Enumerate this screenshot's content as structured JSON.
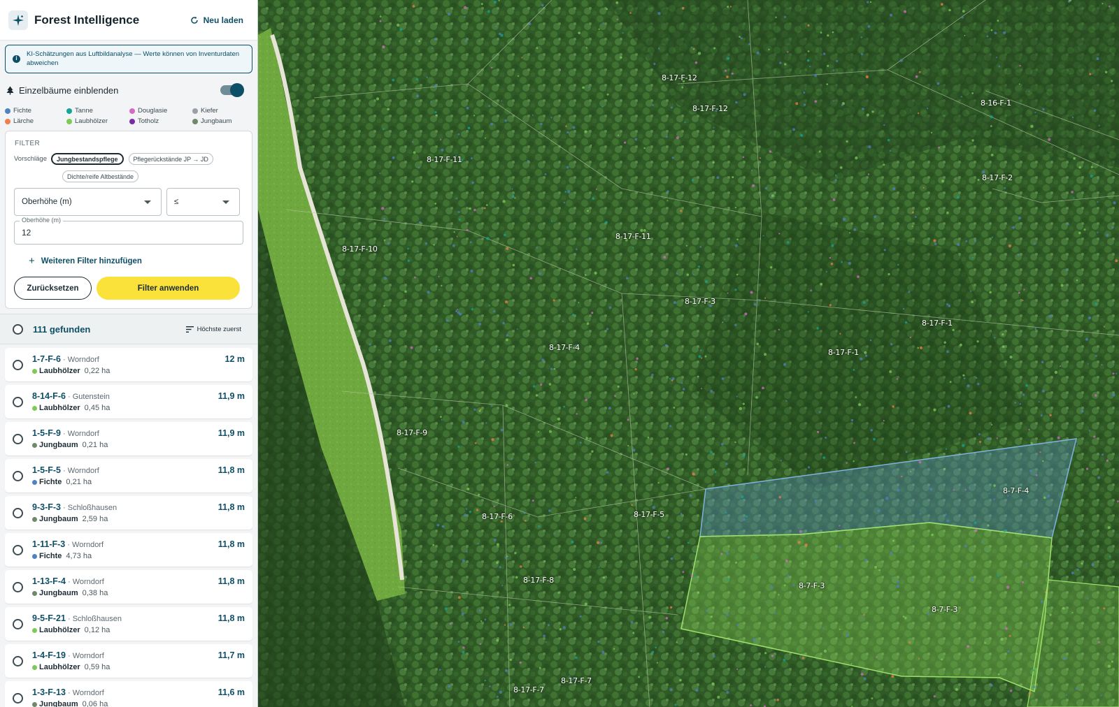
{
  "app": {
    "title": "Forest Intelligence",
    "reload_label": "Neu laden"
  },
  "info": {
    "text": "KI-Schätzungen aus Luftbildanalyse — Werte können von Inventurdaten abweichen"
  },
  "trees_toggle": {
    "label": "Einzelbäume einblenden",
    "on": true
  },
  "legend": [
    {
      "label": "Fichte",
      "color": "#4f82c0"
    },
    {
      "label": "Tanne",
      "color": "#13a59a"
    },
    {
      "label": "Douglasie",
      "color": "#d36dc4"
    },
    {
      "label": "Kiefer",
      "color": "#9aa0a6"
    },
    {
      "label": "Lärche",
      "color": "#f07f4a"
    },
    {
      "label": "Laubhölzer",
      "color": "#7dcb57"
    },
    {
      "label": "Totholz",
      "color": "#7b2aa6"
    },
    {
      "label": "Jungbaum",
      "color": "#6f8a6a"
    }
  ],
  "filter": {
    "heading": "FILTER",
    "suggestions_label": "Vorschläge",
    "suggestions": [
      "Jungbestandspflege",
      "Pflegerückstände JP → JD",
      "Dichte/reife Altbestände"
    ],
    "field_select": "Oberhöhe (m)",
    "operator_select": "≤",
    "value_label": "Oberhöhe (m)",
    "value": "12",
    "add_filter_label": "Weiteren Filter hinzufügen",
    "reset_label": "Zurücksetzen",
    "apply_label": "Filter anwenden"
  },
  "results": {
    "count_label": "111 gefunden",
    "sort_label": "Höchste zuerst",
    "items": [
      {
        "id": "1-7-F-6",
        "loc": " · Worndorf",
        "species": "Laubhölzer",
        "species_color": "#7dcb57",
        "area": "0,22 ha",
        "height": "12 m"
      },
      {
        "id": "8-14-F-6",
        "loc": " · Gutenstein",
        "species": "Laubhölzer",
        "species_color": "#7dcb57",
        "area": "0,45 ha",
        "height": "11,9 m"
      },
      {
        "id": "1-5-F-9",
        "loc": " · Worndorf",
        "species": "Jungbaum",
        "species_color": "#6f8a6a",
        "area": "0,21 ha",
        "height": "11,9 m"
      },
      {
        "id": "1-5-F-5",
        "loc": " · Worndorf",
        "species": "Fichte",
        "species_color": "#4f82c0",
        "area": "0,21 ha",
        "height": "11,8 m"
      },
      {
        "id": "9-3-F-3",
        "loc": " · Schloßhausen",
        "species": "Jungbaum",
        "species_color": "#6f8a6a",
        "area": "2,59 ha",
        "height": "11,8 m"
      },
      {
        "id": "1-11-F-3",
        "loc": " · Worndorf",
        "species": "Fichte",
        "species_color": "#4f82c0",
        "area": "4,73 ha",
        "height": "11,8 m"
      },
      {
        "id": "1-13-F-4",
        "loc": " · Worndorf",
        "species": "Jungbaum",
        "species_color": "#6f8a6a",
        "area": "0,38 ha",
        "height": "11,8 m"
      },
      {
        "id": "9-5-F-21",
        "loc": " · Schloßhausen",
        "species": "Laubhölzer",
        "species_color": "#7dcb57",
        "area": "0,12 ha",
        "height": "11,8 m"
      },
      {
        "id": "1-4-F-19",
        "loc": " · Worndorf",
        "species": "Laubhölzer",
        "species_color": "#7dcb57",
        "area": "0,59 ha",
        "height": "11,7 m"
      },
      {
        "id": "1-3-F-13",
        "loc": " · Worndorf",
        "species": "Jungbaum",
        "species_color": "#6f8a6a",
        "area": "0,06 ha",
        "height": "11,6 m"
      }
    ]
  },
  "map": {
    "stand_labels": [
      "8-17-F-12",
      "8-17-F-12",
      "8-16-F-1",
      "8-17-F-11",
      "8-17-F-2",
      "8-17-F-11",
      "8-17-F-10",
      "8-17-F-3",
      "8-17-F-1",
      "8-17-F-4",
      "8-17-F-1",
      "8-17-F-9",
      "8-7-F-4",
      "8-17-F-6",
      "8-17-F-5",
      "8-7-F-3",
      "8-7-F-3",
      "8-17-F-8",
      "8-17-F-7",
      "8-17-F-7"
    ],
    "colors": {
      "blue_polygon": "#5b8fbf",
      "green_polygon": "#8fd65a"
    }
  }
}
